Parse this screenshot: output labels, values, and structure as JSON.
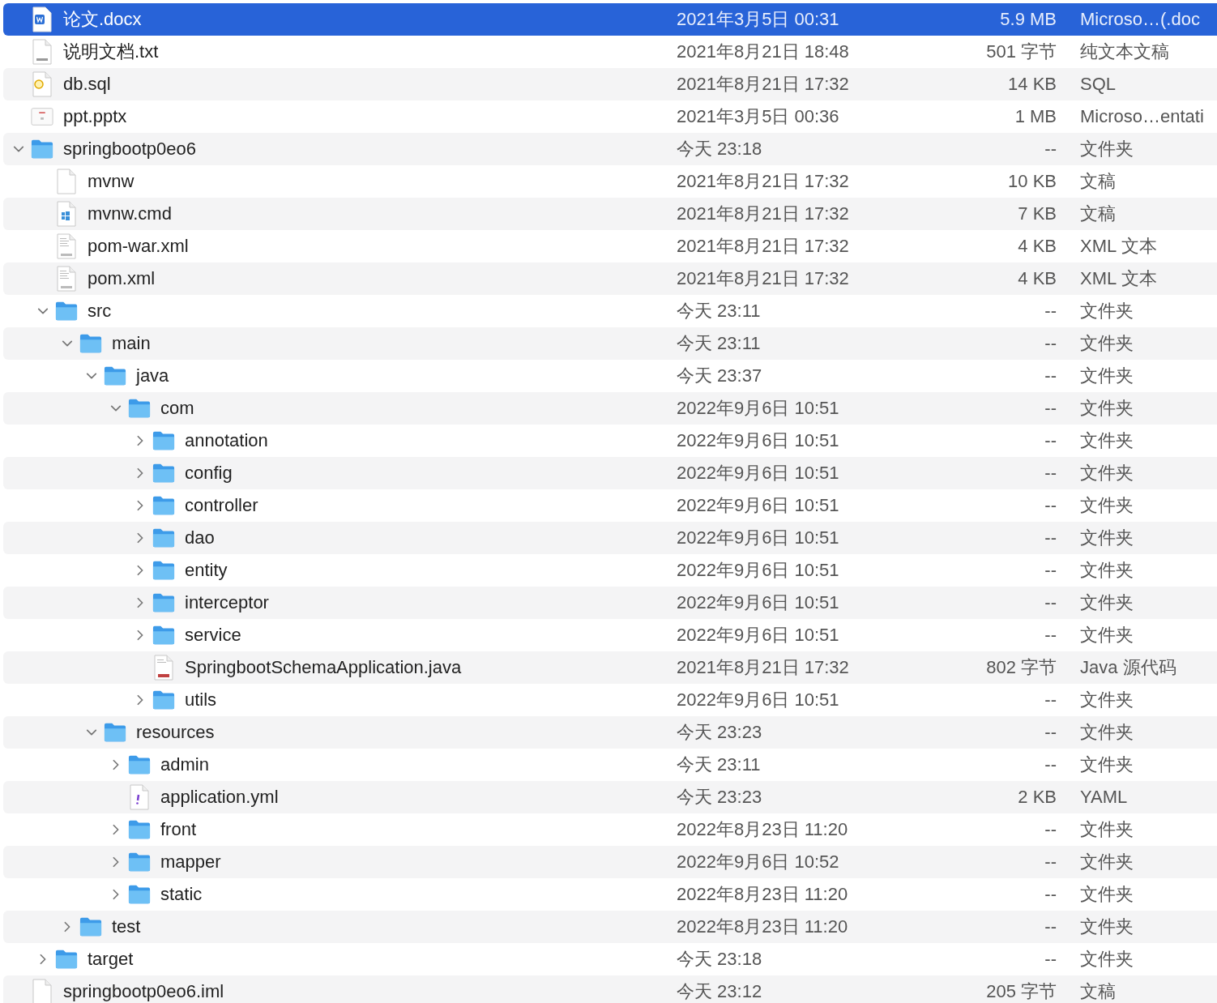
{
  "items": [
    {
      "name": "论文.docx",
      "kind": "docx",
      "date": "2021年3月5日 00:31",
      "size": "5.9 MB",
      "type": "Microso…(.doc",
      "selected": true
    },
    {
      "name": "说明文档.txt",
      "kind": "txt",
      "date": "2021年8月21日 18:48",
      "size": "501 字节",
      "type": "纯文本文稿",
      "selected": false
    },
    {
      "name": "db.sql",
      "kind": "sql",
      "date": "2021年8月21日 17:32",
      "size": "14 KB",
      "type": "SQL",
      "selected": false
    },
    {
      "name": "ppt.pptx",
      "kind": "pptx",
      "date": "2021年3月5日 00:36",
      "size": "1 MB",
      "type": "Microso…entati",
      "selected": false
    },
    {
      "name": "springbootp0eo6",
      "kind": "folder",
      "expanded": true,
      "date": "今天 23:18",
      "size": "--",
      "type": "文件夹",
      "selected": false,
      "children": [
        {
          "name": "mvnw",
          "kind": "blank",
          "date": "2021年8月21日 17:32",
          "size": "10 KB",
          "type": "文稿",
          "selected": false
        },
        {
          "name": "mvnw.cmd",
          "kind": "cmd",
          "date": "2021年8月21日 17:32",
          "size": "7 KB",
          "type": "文稿",
          "selected": false
        },
        {
          "name": "pom-war.xml",
          "kind": "xml",
          "date": "2021年8月21日 17:32",
          "size": "4 KB",
          "type": "XML 文本",
          "selected": false
        },
        {
          "name": "pom.xml",
          "kind": "xml",
          "date": "2021年8月21日 17:32",
          "size": "4 KB",
          "type": "XML 文本",
          "selected": false
        },
        {
          "name": "src",
          "kind": "folder",
          "expanded": true,
          "date": "今天 23:11",
          "size": "--",
          "type": "文件夹",
          "selected": false,
          "children": [
            {
              "name": "main",
              "kind": "folder",
              "expanded": true,
              "date": "今天 23:11",
              "size": "--",
              "type": "文件夹",
              "selected": false,
              "children": [
                {
                  "name": "java",
                  "kind": "folder",
                  "expanded": true,
                  "date": "今天 23:37",
                  "size": "--",
                  "type": "文件夹",
                  "selected": false,
                  "children": [
                    {
                      "name": "com",
                      "kind": "folder",
                      "expanded": true,
                      "date": "2022年9月6日 10:51",
                      "size": "--",
                      "type": "文件夹",
                      "selected": false,
                      "children": [
                        {
                          "name": "annotation",
                          "kind": "folder",
                          "expanded": false,
                          "date": "2022年9月6日 10:51",
                          "size": "--",
                          "type": "文件夹",
                          "selected": false
                        },
                        {
                          "name": "config",
                          "kind": "folder",
                          "expanded": false,
                          "date": "2022年9月6日 10:51",
                          "size": "--",
                          "type": "文件夹",
                          "selected": false
                        },
                        {
                          "name": "controller",
                          "kind": "folder",
                          "expanded": false,
                          "date": "2022年9月6日 10:51",
                          "size": "--",
                          "type": "文件夹",
                          "selected": false
                        },
                        {
                          "name": "dao",
                          "kind": "folder",
                          "expanded": false,
                          "date": "2022年9月6日 10:51",
                          "size": "--",
                          "type": "文件夹",
                          "selected": false
                        },
                        {
                          "name": "entity",
                          "kind": "folder",
                          "expanded": false,
                          "date": "2022年9月6日 10:51",
                          "size": "--",
                          "type": "文件夹",
                          "selected": false
                        },
                        {
                          "name": "interceptor",
                          "kind": "folder",
                          "expanded": false,
                          "date": "2022年9月6日 10:51",
                          "size": "--",
                          "type": "文件夹",
                          "selected": false
                        },
                        {
                          "name": "service",
                          "kind": "folder",
                          "expanded": false,
                          "date": "2022年9月6日 10:51",
                          "size": "--",
                          "type": "文件夹",
                          "selected": false
                        },
                        {
                          "name": "SpringbootSchemaApplication.java",
                          "kind": "java",
                          "date": "2021年8月21日 17:32",
                          "size": "802 字节",
                          "type": "Java 源代码",
                          "selected": false
                        },
                        {
                          "name": "utils",
                          "kind": "folder",
                          "expanded": false,
                          "date": "2022年9月6日 10:51",
                          "size": "--",
                          "type": "文件夹",
                          "selected": false
                        }
                      ]
                    }
                  ]
                },
                {
                  "name": "resources",
                  "kind": "folder",
                  "expanded": true,
                  "date": "今天 23:23",
                  "size": "--",
                  "type": "文件夹",
                  "selected": false,
                  "children": [
                    {
                      "name": "admin",
                      "kind": "folder",
                      "expanded": false,
                      "date": "今天 23:11",
                      "size": "--",
                      "type": "文件夹",
                      "selected": false
                    },
                    {
                      "name": "application.yml",
                      "kind": "yml",
                      "date": "今天 23:23",
                      "size": "2 KB",
                      "type": "YAML",
                      "selected": false
                    },
                    {
                      "name": "front",
                      "kind": "folder",
                      "expanded": false,
                      "date": "2022年8月23日 11:20",
                      "size": "--",
                      "type": "文件夹",
                      "selected": false
                    },
                    {
                      "name": "mapper",
                      "kind": "folder",
                      "expanded": false,
                      "date": "2022年9月6日 10:52",
                      "size": "--",
                      "type": "文件夹",
                      "selected": false
                    },
                    {
                      "name": "static",
                      "kind": "folder",
                      "expanded": false,
                      "date": "2022年8月23日 11:20",
                      "size": "--",
                      "type": "文件夹",
                      "selected": false
                    }
                  ]
                }
              ]
            },
            {
              "name": "test",
              "kind": "folder",
              "expanded": false,
              "date": "2022年8月23日 11:20",
              "size": "--",
              "type": "文件夹",
              "selected": false
            }
          ]
        },
        {
          "name": "target",
          "kind": "folder",
          "expanded": false,
          "date": "今天 23:18",
          "size": "--",
          "type": "文件夹",
          "selected": false
        }
      ]
    },
    {
      "name": "springbootp0eo6.iml",
      "kind": "blank",
      "date": "今天 23:12",
      "size": "205 字节",
      "type": "文稿",
      "selected": false
    }
  ]
}
